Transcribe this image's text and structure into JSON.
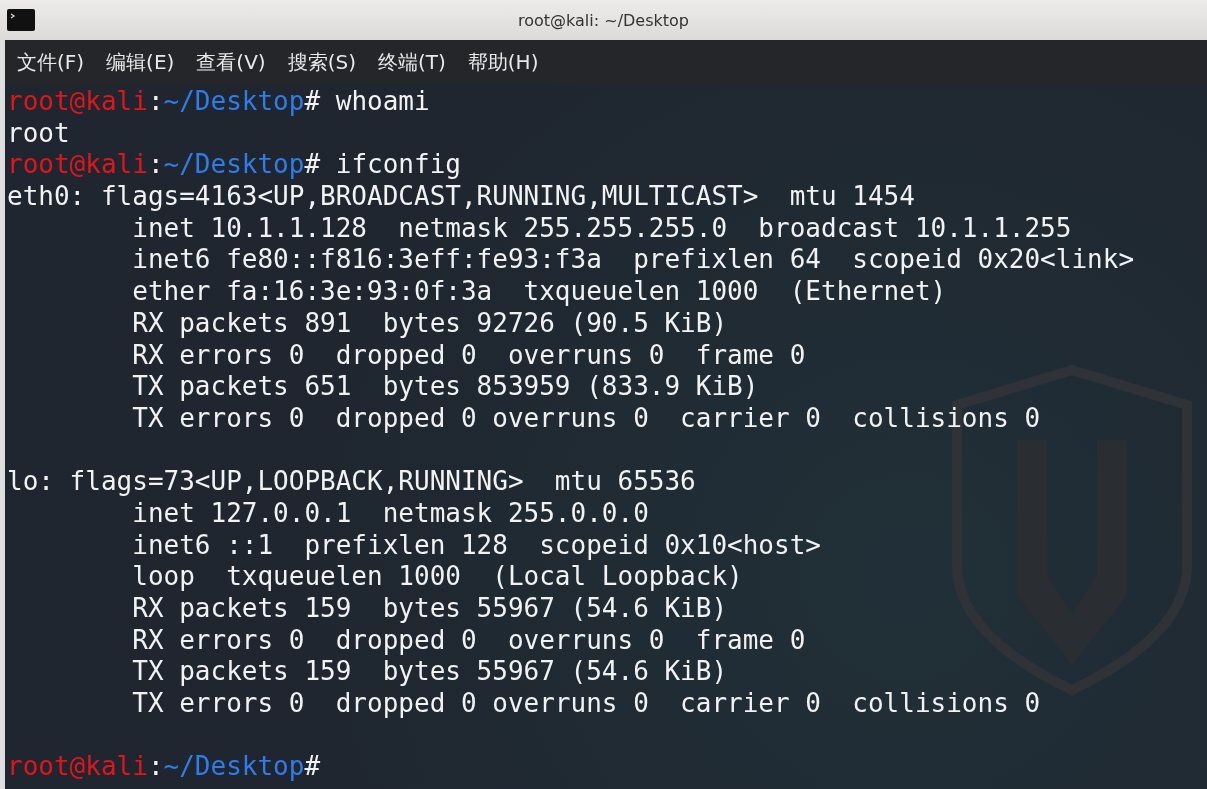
{
  "window": {
    "title": "root@kali: ~/Desktop"
  },
  "menu": [
    "文件(F)",
    "编辑(E)",
    "查看(V)",
    "搜索(S)",
    "终端(T)",
    "帮助(H)"
  ],
  "lines": [
    {
      "kind": "prompt",
      "user": "root@kali",
      "sep": ":",
      "path": "~/Desktop",
      "mark": "#",
      "command": "whoami"
    },
    {
      "kind": "output",
      "text": "root"
    },
    {
      "kind": "prompt",
      "user": "root@kali",
      "sep": ":",
      "path": "~/Desktop",
      "mark": "#",
      "command": "ifconfig"
    },
    {
      "kind": "output",
      "text": "eth0: flags=4163<UP,BROADCAST,RUNNING,MULTICAST>  mtu 1454"
    },
    {
      "kind": "output",
      "text": "        inet 10.1.1.128  netmask 255.255.255.0  broadcast 10.1.1.255"
    },
    {
      "kind": "output",
      "text": "        inet6 fe80::f816:3eff:fe93:f3a  prefixlen 64  scopeid 0x20<link>"
    },
    {
      "kind": "output",
      "text": "        ether fa:16:3e:93:0f:3a  txqueuelen 1000  (Ethernet)"
    },
    {
      "kind": "output",
      "text": "        RX packets 891  bytes 92726 (90.5 KiB)"
    },
    {
      "kind": "output",
      "text": "        RX errors 0  dropped 0  overruns 0  frame 0"
    },
    {
      "kind": "output",
      "text": "        TX packets 651  bytes 853959 (833.9 KiB)"
    },
    {
      "kind": "output",
      "text": "        TX errors 0  dropped 0 overruns 0  carrier 0  collisions 0"
    },
    {
      "kind": "blank"
    },
    {
      "kind": "output",
      "text": "lo: flags=73<UP,LOOPBACK,RUNNING>  mtu 65536"
    },
    {
      "kind": "output",
      "text": "        inet 127.0.0.1  netmask 255.0.0.0"
    },
    {
      "kind": "output",
      "text": "        inet6 ::1  prefixlen 128  scopeid 0x10<host>"
    },
    {
      "kind": "output",
      "text": "        loop  txqueuelen 1000  (Local Loopback)"
    },
    {
      "kind": "output",
      "text": "        RX packets 159  bytes 55967 (54.6 KiB)"
    },
    {
      "kind": "output",
      "text": "        RX errors 0  dropped 0  overruns 0  frame 0"
    },
    {
      "kind": "output",
      "text": "        TX packets 159  bytes 55967 (54.6 KiB)"
    },
    {
      "kind": "output",
      "text": "        TX errors 0  dropped 0 overruns 0  carrier 0  collisions 0"
    },
    {
      "kind": "blank"
    },
    {
      "kind": "prompt",
      "user": "root@kali",
      "sep": ":",
      "path": "~/Desktop",
      "mark": "#"
    }
  ]
}
